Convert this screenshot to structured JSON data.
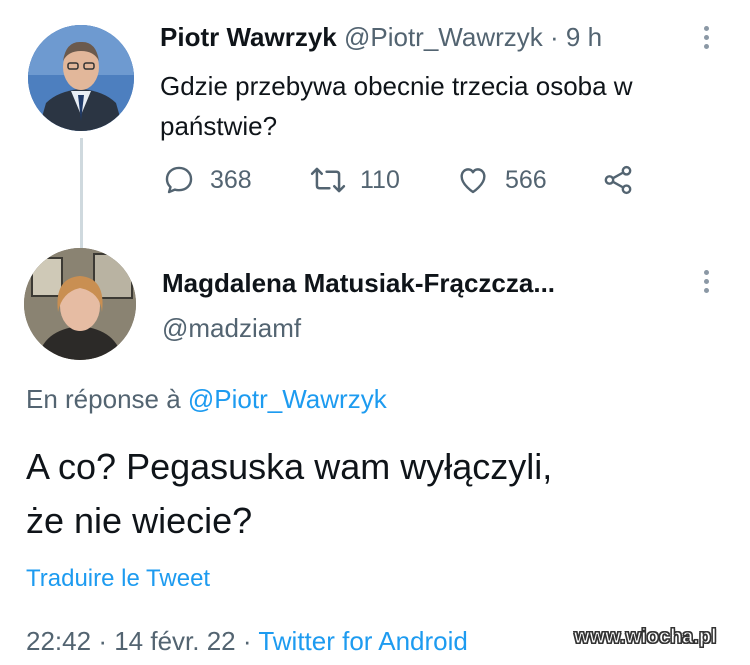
{
  "tweet": {
    "author_name": "Piotr Wawrzyk",
    "author_handle": "@Piotr_Wawrzyk",
    "separator": "·",
    "time_ago": "9 h",
    "text": "Gdzie przebywa obecnie trzecia osoba w państwie?",
    "actions": {
      "replies": "368",
      "retweets": "110",
      "likes": "566"
    }
  },
  "reply": {
    "author_name": "Magdalena Matusiak-Frączcza...",
    "author_handle": "@madziamf",
    "reply_prefix": "En réponse à",
    "reply_to": "@Piotr_Wawrzyk",
    "text_line1": "A co? Pegasuska wam wyłączyli,",
    "text_line2": "że nie wiecie?",
    "translate_label": "Traduire le Tweet",
    "timestamp_time": "22:42",
    "timestamp_date": "14 févr. 22",
    "separator": "·",
    "source": "Twitter for Android"
  },
  "watermark": "www.wiocha.pl",
  "colors": {
    "link": "#1d9bf0",
    "muted": "#536471",
    "text": "#0f1419"
  }
}
